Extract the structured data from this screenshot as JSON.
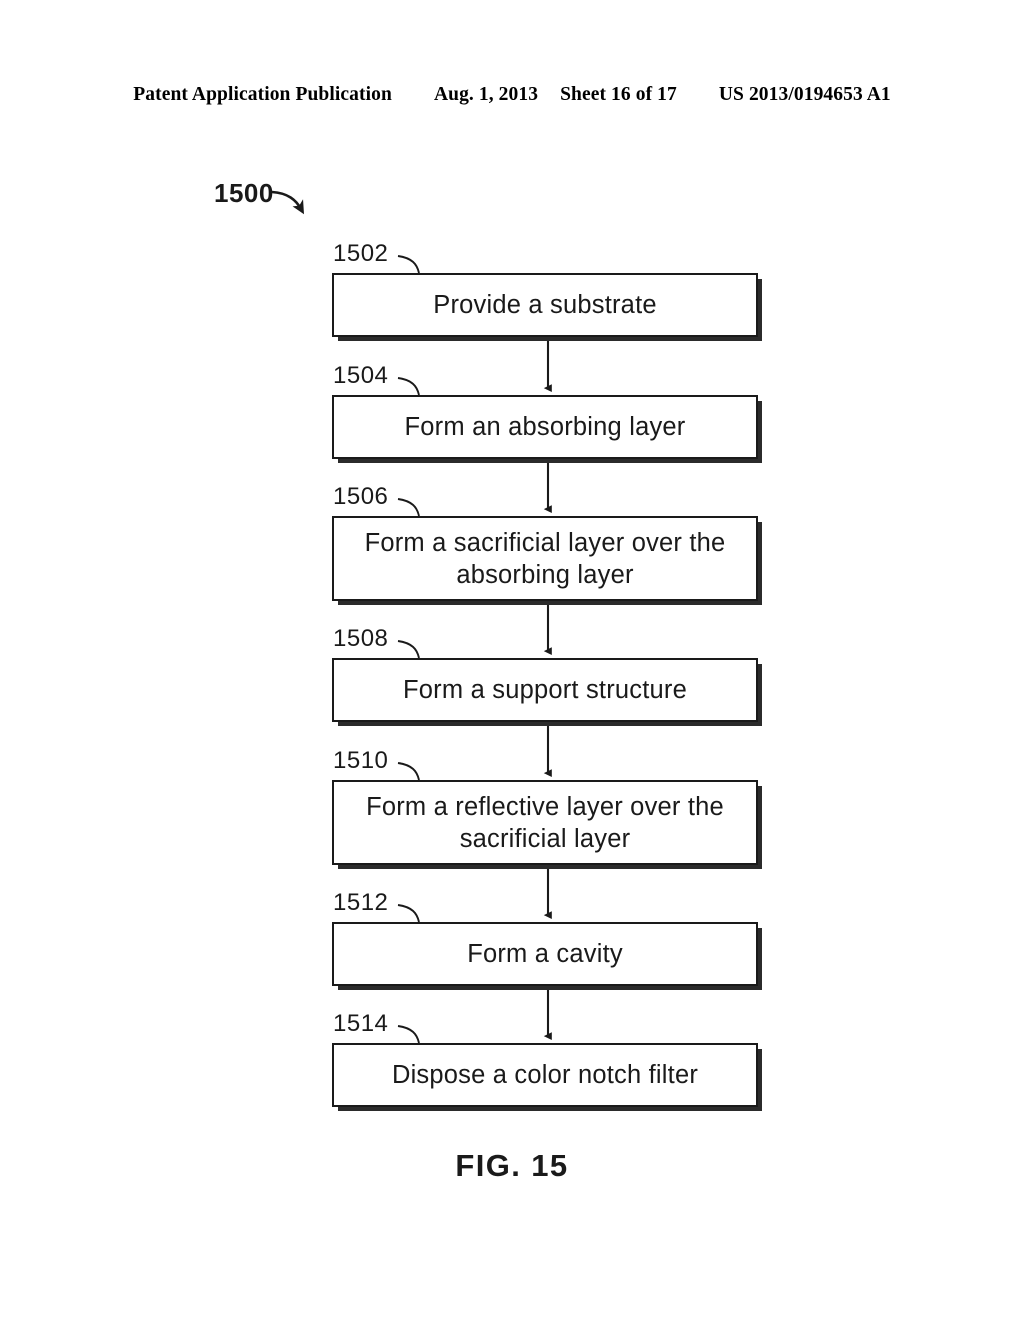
{
  "header": {
    "publication": "Patent Application Publication",
    "date": "Aug. 1, 2013",
    "sheet": "Sheet 16 of 17",
    "patent_number": "US 2013/0194653 A1"
  },
  "figure": {
    "caption": "FIG. 15",
    "flow_id": "1500",
    "ink_color": "#1a1a1a",
    "background": "#ffffff"
  },
  "flowchart": {
    "steps": [
      {
        "ref": "1502",
        "label": "Provide a substrate"
      },
      {
        "ref": "1504",
        "label": "Form an absorbing layer"
      },
      {
        "ref": "1506",
        "label": "Form a sacrificial layer over the\nabsorbing layer"
      },
      {
        "ref": "1508",
        "label": "Form a support structure"
      },
      {
        "ref": "1510",
        "label": "Form a reflective layer over the\nsacrificial layer"
      },
      {
        "ref": "1512",
        "label": "Form a cavity"
      },
      {
        "ref": "1514",
        "label": "Dispose a color notch filter"
      }
    ]
  }
}
